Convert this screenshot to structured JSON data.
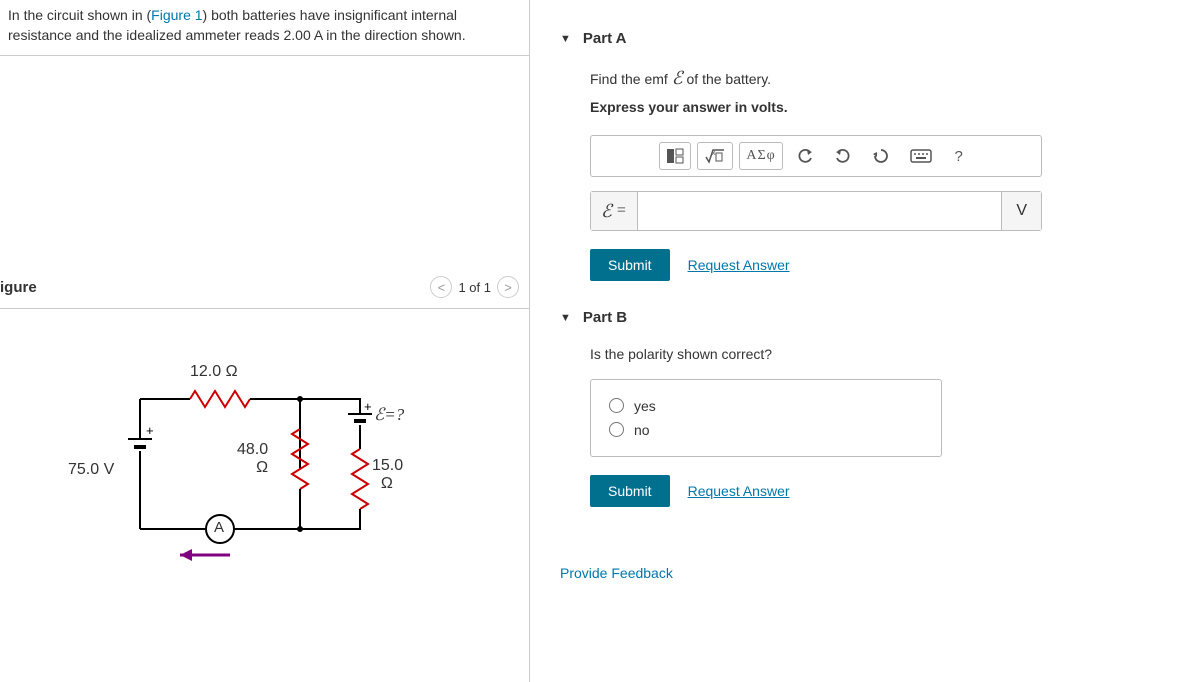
{
  "problem": {
    "prefix": "In the circuit shown in (",
    "figure_link": "Figure 1",
    "suffix": ") both batteries have insignificant internal resistance and the idealized ammeter reads 2.00 A in the direction shown."
  },
  "figure": {
    "title": "igure",
    "pager": "1 of 1",
    "r1": "12.0 Ω",
    "r2": "48.0",
    "r2_unit": "Ω",
    "r3": "15.0",
    "r3_unit": "Ω",
    "v1": "75.0 V",
    "emf_label": "ℰ=?",
    "ammeter": "A"
  },
  "partA": {
    "title": "Part A",
    "prompt": "Find the emf ℰ of the battery.",
    "instruction": "Express your answer in volts.",
    "greek_label": "ΑΣφ",
    "help_label": "?",
    "prefix": "ℰ =",
    "suffix": "V",
    "submit": "Submit",
    "request": "Request Answer"
  },
  "partB": {
    "title": "Part B",
    "prompt": "Is the polarity shown correct?",
    "opt_yes": "yes",
    "opt_no": "no",
    "submit": "Submit",
    "request": "Request Answer"
  },
  "feedback": "Provide Feedback"
}
